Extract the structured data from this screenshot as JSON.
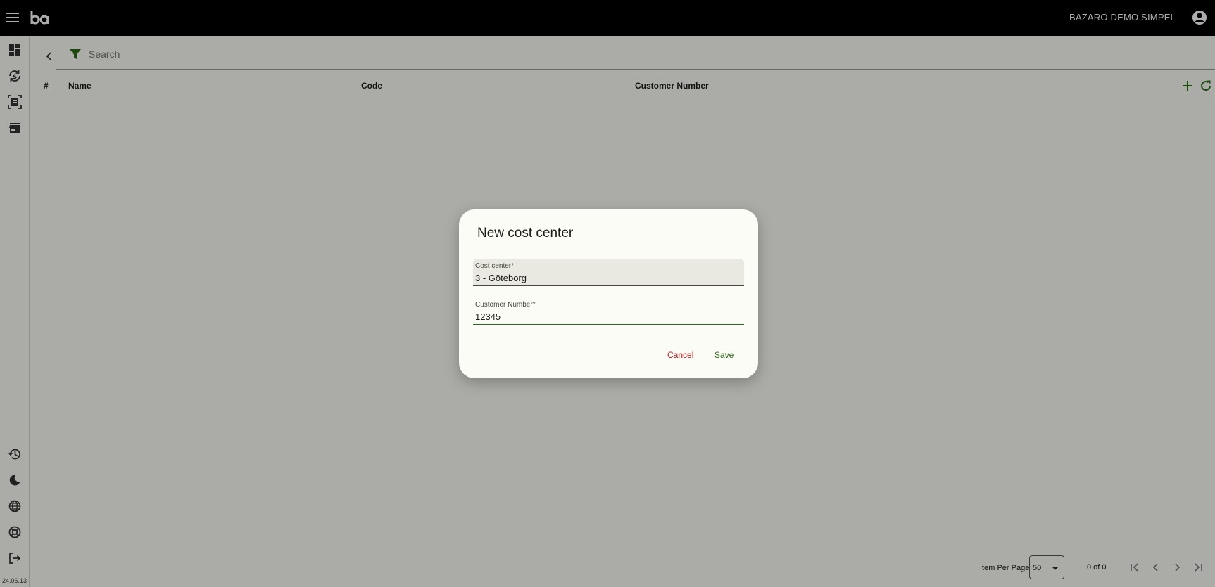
{
  "header": {
    "company": "BAZARO DEMO SIMPEL",
    "logo_text": "ba"
  },
  "sidebar": {
    "top_items": [
      {
        "icon": "dashboard-icon"
      },
      {
        "icon": "currency-exchange-icon"
      },
      {
        "icon": "receipt-scan-icon"
      },
      {
        "icon": "store-icon"
      }
    ],
    "bottom_items": [
      {
        "icon": "history-icon"
      },
      {
        "icon": "dark-mode-icon"
      },
      {
        "icon": "language-globe-icon"
      },
      {
        "icon": "support-lifebuoy-icon"
      },
      {
        "icon": "logout-icon"
      }
    ],
    "version": "24.06.13"
  },
  "toolbar": {
    "search_placeholder": "Search"
  },
  "table": {
    "columns": [
      "#",
      "Name",
      "Code",
      "Customer Number"
    ],
    "rows": []
  },
  "paginator": {
    "items_per_page_label": "Item Per Page",
    "items_per_page": "50",
    "range": "0 of 0"
  },
  "dialog": {
    "title": "New cost center",
    "fields": [
      {
        "label": "Cost center*",
        "value": "3 - Göteborg"
      },
      {
        "label": "Customer Number*",
        "value": "12345"
      }
    ],
    "cancel_label": "Cancel",
    "save_label": "Save"
  },
  "colors": {
    "accent": "#2b6a16",
    "danger": "#ba1a1a",
    "topbar": "#000000",
    "surface": "#fcfcf6"
  }
}
